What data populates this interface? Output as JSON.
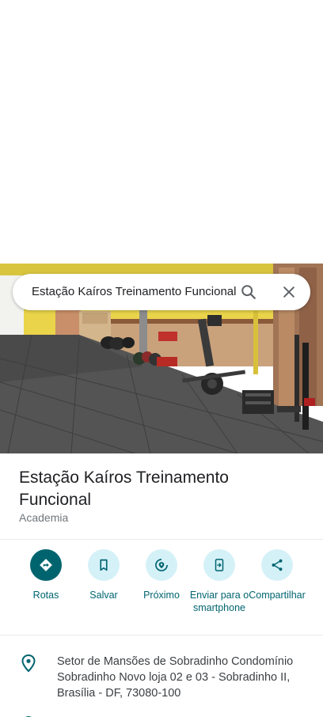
{
  "search": {
    "query": "Estação Kaíros Treinamento Funcional"
  },
  "place": {
    "name": "Estação Kaíros Treinamento Funcional",
    "category": "Academia"
  },
  "actions": [
    {
      "label": "Rotas",
      "icon": "directions-icon"
    },
    {
      "label": "Salvar",
      "icon": "bookmark-icon"
    },
    {
      "label": "Próximo",
      "icon": "nearby-icon"
    },
    {
      "label": "Enviar para o smartphone",
      "icon": "send-to-phone-icon"
    },
    {
      "label": "Compartilhar",
      "icon": "share-icon"
    }
  ],
  "address": {
    "text": "Setor de Mansões de Sobradinho Condomínio Sobradinho Novo loja 02 e 03 - Sobradinho II, Brasília - DF, 73080-100",
    "icon": "location-pin-icon"
  },
  "colors": {
    "accent": "#00646f",
    "action_bg": "#d5f1f8",
    "title": "#202124",
    "secondary": "#70757a"
  }
}
